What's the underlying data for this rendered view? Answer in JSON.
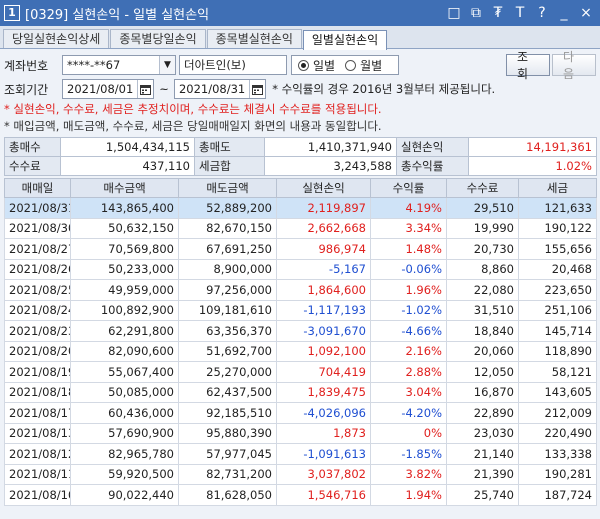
{
  "window": {
    "screen_no": "1",
    "title": "[0329] 실현손익 - 일별 실현손익",
    "buttons": [
      "□",
      "⧉",
      "₮",
      "T",
      "?",
      "_",
      "×"
    ]
  },
  "tabs": [
    {
      "label": "당일실현손익상세",
      "active": false
    },
    {
      "label": "종목별당일손익",
      "active": false
    },
    {
      "label": "종목별실현손익",
      "active": false
    },
    {
      "label": "일별실현손익",
      "active": true
    }
  ],
  "account": {
    "label": "계좌번호",
    "number": "****-**67",
    "name": "더아트인(보)"
  },
  "period_mode": {
    "options": [
      "일별",
      "월별"
    ],
    "selected": "일별"
  },
  "buttons": {
    "query": "조회",
    "next": "다음"
  },
  "query_period": {
    "label": "조회기간",
    "start": "2021/08/01",
    "separator": "~",
    "end": "2021/08/31",
    "note": "* 수익률의 경우 2016년 3월부터 제공됩니다."
  },
  "notes": {
    "red": "* 실현손익, 수수료, 세금은 추정치이며, 수수료는 체결시 수수료를 적용됩니다.",
    "dark": "* 매입금액, 매도금액, 수수료, 세금은 당일매매일지 화면의 내용과 동일합니다."
  },
  "summary": {
    "row1": [
      {
        "label": "총매수",
        "value": "1,504,434,115"
      },
      {
        "label": "총매도",
        "value": "1,410,371,940"
      },
      {
        "label": "실현손익",
        "value": "14,191,361"
      }
    ],
    "row2": [
      {
        "label": "수수료",
        "value": "437,110"
      },
      {
        "label": "세금합",
        "value": "3,243,588"
      },
      {
        "label": "총수익률",
        "value": "1.02%"
      }
    ]
  },
  "grid": {
    "columns": [
      "매매일",
      "매수금액",
      "매도금액",
      "실현손익",
      "수익률",
      "수수료",
      "세금"
    ],
    "rows": [
      {
        "date": "2021/08/31",
        "buy": "143,865,400",
        "sell": "52,889,200",
        "pnl": "2,119,897",
        "rate": "4.19%",
        "fee": "29,510",
        "tax": "121,633",
        "sign": "pos"
      },
      {
        "date": "2021/08/30",
        "buy": "50,632,150",
        "sell": "82,670,150",
        "pnl": "2,662,668",
        "rate": "3.34%",
        "fee": "19,990",
        "tax": "190,122",
        "sign": "pos"
      },
      {
        "date": "2021/08/27",
        "buy": "70,569,800",
        "sell": "67,691,250",
        "pnl": "986,974",
        "rate": "1.48%",
        "fee": "20,730",
        "tax": "155,656",
        "sign": "pos"
      },
      {
        "date": "2021/08/26",
        "buy": "50,233,000",
        "sell": "8,900,000",
        "pnl": "-5,167",
        "rate": "-0.06%",
        "fee": "8,860",
        "tax": "20,468",
        "sign": "neg"
      },
      {
        "date": "2021/08/25",
        "buy": "49,959,000",
        "sell": "97,256,000",
        "pnl": "1,864,600",
        "rate": "1.96%",
        "fee": "22,080",
        "tax": "223,650",
        "sign": "pos"
      },
      {
        "date": "2021/08/24",
        "buy": "100,892,900",
        "sell": "109,181,610",
        "pnl": "-1,117,193",
        "rate": "-1.02%",
        "fee": "31,510",
        "tax": "251,106",
        "sign": "neg"
      },
      {
        "date": "2021/08/23",
        "buy": "62,291,800",
        "sell": "63,356,370",
        "pnl": "-3,091,670",
        "rate": "-4.66%",
        "fee": "18,840",
        "tax": "145,714",
        "sign": "neg"
      },
      {
        "date": "2021/08/20",
        "buy": "82,090,600",
        "sell": "51,692,700",
        "pnl": "1,092,100",
        "rate": "2.16%",
        "fee": "20,060",
        "tax": "118,890",
        "sign": "pos"
      },
      {
        "date": "2021/08/19",
        "buy": "55,067,400",
        "sell": "25,270,000",
        "pnl": "704,419",
        "rate": "2.88%",
        "fee": "12,050",
        "tax": "58,121",
        "sign": "pos"
      },
      {
        "date": "2021/08/18",
        "buy": "50,085,000",
        "sell": "62,437,500",
        "pnl": "1,839,475",
        "rate": "3.04%",
        "fee": "16,870",
        "tax": "143,605",
        "sign": "pos"
      },
      {
        "date": "2021/08/17",
        "buy": "60,436,000",
        "sell": "92,185,510",
        "pnl": "-4,026,096",
        "rate": "-4.20%",
        "fee": "22,890",
        "tax": "212,009",
        "sign": "neg"
      },
      {
        "date": "2021/08/13",
        "buy": "57,690,900",
        "sell": "95,880,390",
        "pnl": "1,873",
        "rate": "0%",
        "fee": "23,030",
        "tax": "220,490",
        "sign": "pos"
      },
      {
        "date": "2021/08/12",
        "buy": "82,965,780",
        "sell": "57,977,045",
        "pnl": "-1,091,613",
        "rate": "-1.85%",
        "fee": "21,140",
        "tax": "133,338",
        "sign": "neg"
      },
      {
        "date": "2021/08/11",
        "buy": "59,920,500",
        "sell": "82,731,200",
        "pnl": "3,037,802",
        "rate": "3.82%",
        "fee": "21,390",
        "tax": "190,281",
        "sign": "pos"
      },
      {
        "date": "2021/08/10",
        "buy": "90,022,440",
        "sell": "81,628,050",
        "pnl": "1,546,716",
        "rate": "1.94%",
        "fee": "25,740",
        "tax": "187,724",
        "sign": "pos"
      }
    ],
    "selected_row": 0
  },
  "colors": {
    "titlebar": "#3f6fb5",
    "positive": "#e0201e",
    "negative": "#1f4fd1",
    "selected_row": "#cfe3f7"
  }
}
